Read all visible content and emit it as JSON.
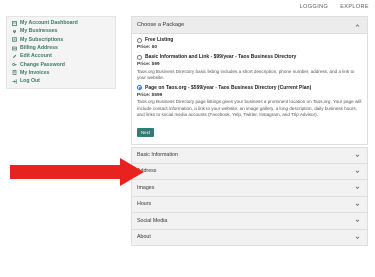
{
  "topnav": {
    "links": [
      "LOGGING",
      "EXPLORE"
    ]
  },
  "sidebar": {
    "items": [
      {
        "label": "My Account Dashboard",
        "icon": "dashboard-icon"
      },
      {
        "label": "My Businesses",
        "icon": "map-pin-icon"
      },
      {
        "label": "My Subscriptions",
        "icon": "subscription-icon"
      },
      {
        "label": "Billing Address",
        "icon": "billing-icon"
      },
      {
        "label": "Edit Account",
        "icon": "edit-icon"
      },
      {
        "label": "Change Password",
        "icon": "key-icon"
      },
      {
        "label": "My Invoices",
        "icon": "invoice-icon"
      },
      {
        "label": "Log Out",
        "icon": "logout-icon"
      }
    ]
  },
  "package_panel": {
    "title": "Choose a Package",
    "options": [
      {
        "title": "Free Listing",
        "price": "Price: $0",
        "description": "",
        "selected": false
      },
      {
        "title": "Basic Information and Link - $99/year - Taos Business Directory",
        "price": "Price: $99",
        "description": "Taos.org Business Directory basic listing includes a short description, phone number, address, and a link to your website.",
        "selected": false
      },
      {
        "title": "Page on Taos.org - $599/year - Taos Business Directory  (Current Plan)",
        "price": "Price: $599",
        "description": "Taos.org Business Directory page listings gives your business a prominent location on Taos.org. Your page will include contact information, a link to your website, an image gallery, a long description, daily business hours, and links to social media accounts (Facebook, Yelp, Twitter, Instagram, and Trip Advisor).",
        "selected": true
      }
    ],
    "next_label": "Next"
  },
  "sections": [
    "Basic Information",
    "Address",
    "Images",
    "Hours",
    "Social Media",
    "About"
  ],
  "colors": {
    "accent": "#3d7a63",
    "button": "#2f7d74",
    "arrow": "#e8231f",
    "radio": "#2a6fd6"
  }
}
